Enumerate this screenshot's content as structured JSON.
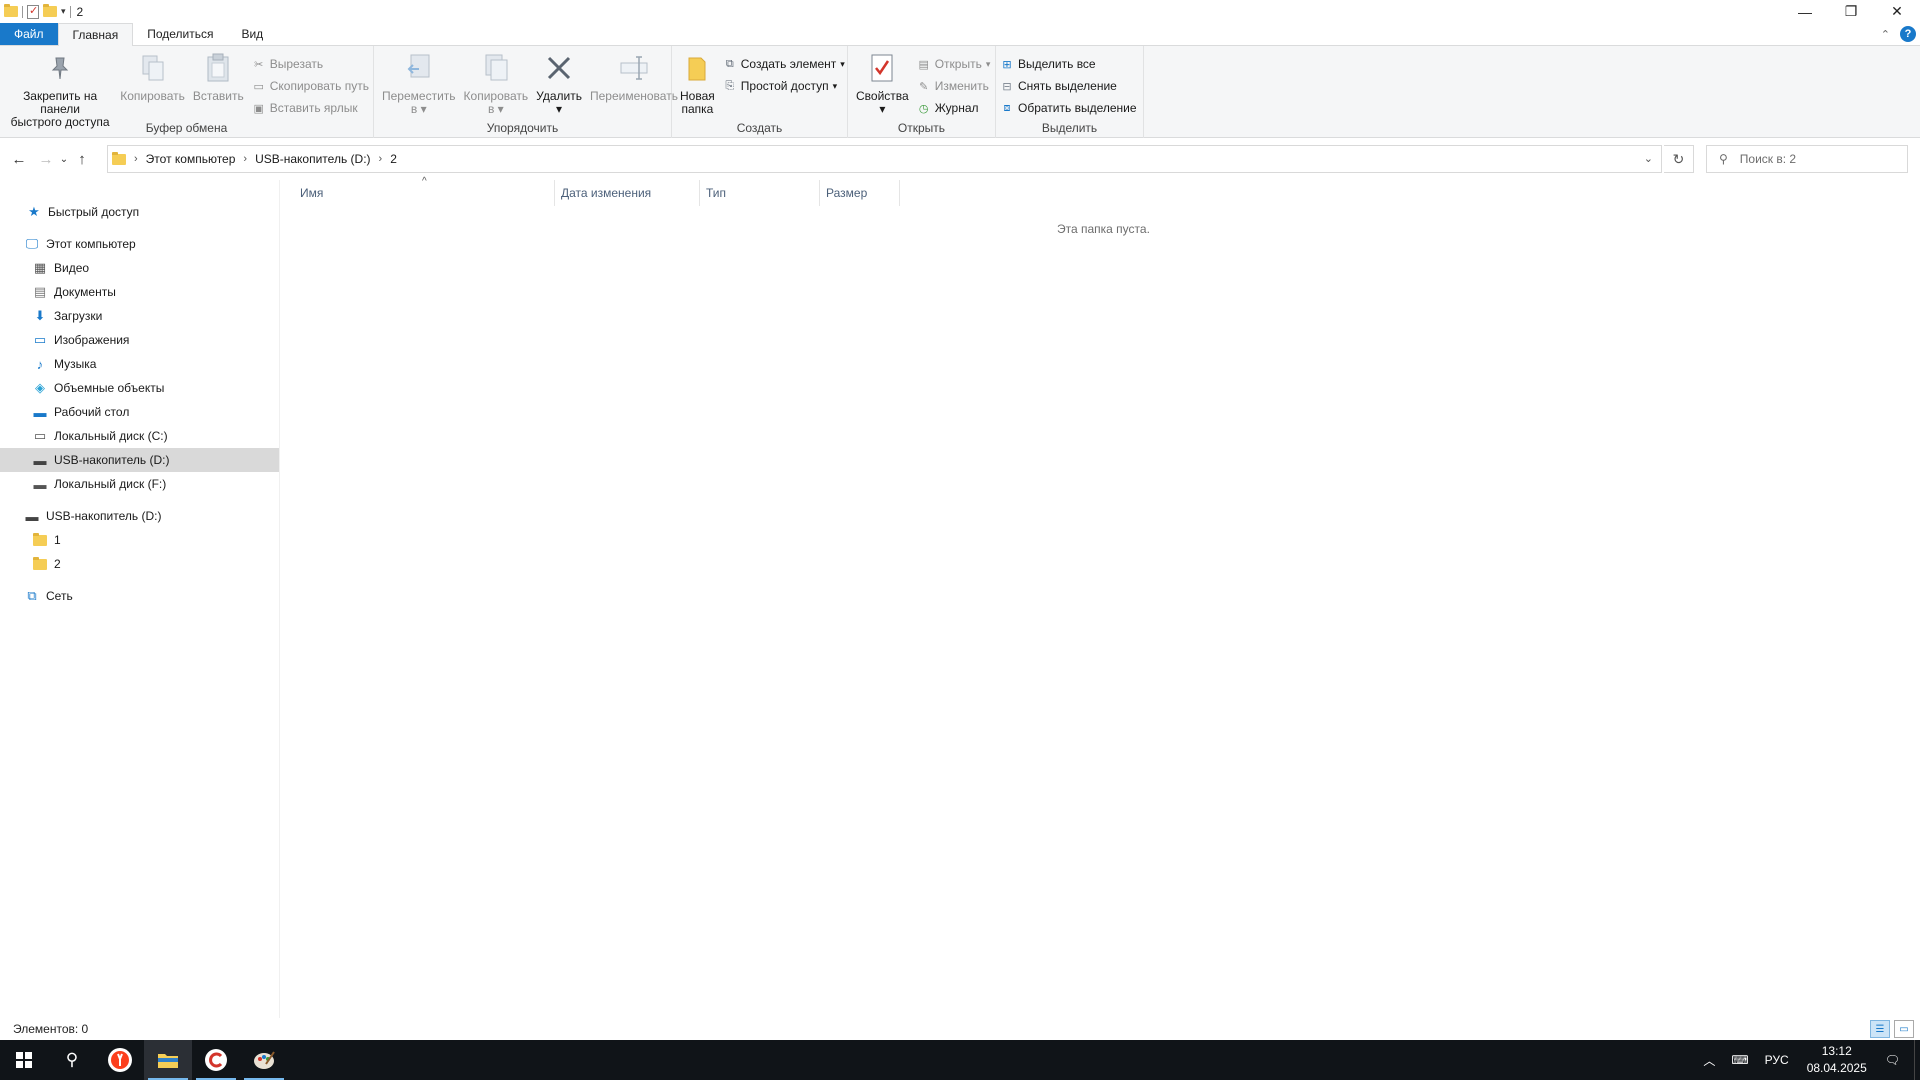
{
  "window": {
    "title": "2",
    "controls": {
      "minimize": "—",
      "maximize": "❐",
      "close": "✕"
    }
  },
  "ribbon_tabs": [
    "Файл",
    "Главная",
    "Поделиться",
    "Вид"
  ],
  "ribbon": {
    "clipboard": {
      "label": "Буфер обмена",
      "pin": "Закрепить на панели быстрого доступа",
      "pin_l1": "Закрепить на панели",
      "pin_l2": "быстрого доступа",
      "copy": "Копировать",
      "paste": "Вставить",
      "cut": "Вырезать",
      "copy_path": "Скопировать путь",
      "paste_shortcut": "Вставить ярлык"
    },
    "organize": {
      "label": "Упорядочить",
      "move_l1": "Переместить",
      "move_l2": "в",
      "copy_l1": "Копировать",
      "copy_l2": "в",
      "delete": "Удалить",
      "rename": "Переименовать"
    },
    "create": {
      "label": "Создать",
      "new_folder_l1": "Новая",
      "new_folder_l2": "папка",
      "new_item": "Создать элемент",
      "easy_access": "Простой доступ"
    },
    "open": {
      "label": "Открыть",
      "properties": "Свойства",
      "open": "Открыть",
      "edit": "Изменить",
      "history": "Журнал"
    },
    "select": {
      "label": "Выделить",
      "select_all": "Выделить все",
      "select_none": "Снять выделение",
      "invert": "Обратить выделение"
    }
  },
  "address": {
    "crumbs": [
      "Этот компьютер",
      "USB-накопитель (D:)",
      "2"
    ],
    "search_placeholder": "Поиск в: 2"
  },
  "nav": {
    "quick_access": "Быстрый доступ",
    "this_pc": "Этот компьютер",
    "pc_items": [
      "Видео",
      "Документы",
      "Загрузки",
      "Изображения",
      "Музыка",
      "Объемные объекты",
      "Рабочий стол",
      "Локальный диск (C:)",
      "USB-накопитель (D:)",
      "Локальный диск (F:)"
    ],
    "usb": "USB-накопитель (D:)",
    "usb_items": [
      "1",
      "2"
    ],
    "network": "Сеть"
  },
  "columns": [
    "Имя",
    "Дата изменения",
    "Тип",
    "Размер"
  ],
  "empty_message": "Эта папка пуста.",
  "status": {
    "items": "Элементов: 0"
  },
  "taskbar": {
    "lang": "РУС",
    "time": "13:12",
    "date": "08.04.2025"
  },
  "colors": {
    "accent": "#1979ca",
    "selected": "#d9d9d9",
    "taskbar": "#101418"
  }
}
